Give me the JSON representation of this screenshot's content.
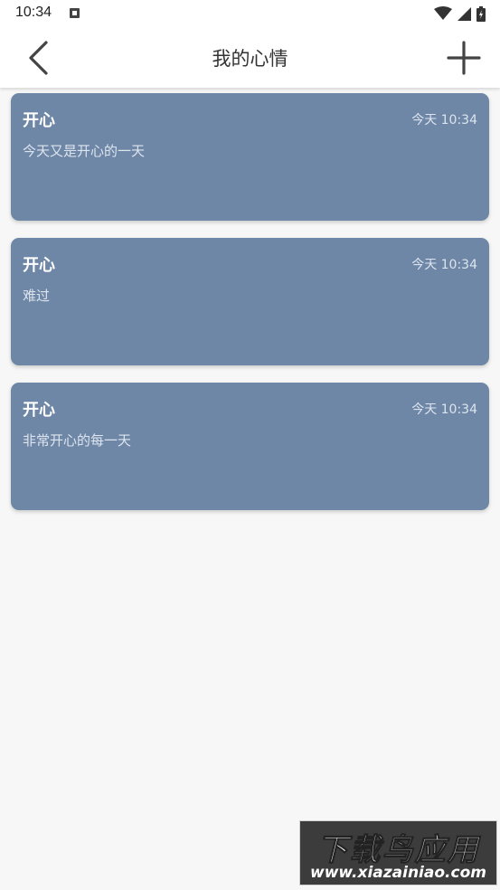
{
  "status_bar": {
    "time": "10:34",
    "notification_icon": "a-notification-icon",
    "icons": [
      "wifi-icon",
      "signal-icon",
      "battery-icon"
    ]
  },
  "app_bar": {
    "title": "我的心情",
    "back_icon": "chevron-left-icon",
    "add_icon": "plus-icon"
  },
  "moods": [
    {
      "mood": "开心",
      "time": "今天 10:34",
      "text": "今天又是开心的一天"
    },
    {
      "mood": "开心",
      "time": "今天 10:34",
      "text": "难过"
    },
    {
      "mood": "开心",
      "time": "今天 10:34",
      "text": "非常开心的每一天"
    }
  ],
  "watermark": {
    "brand": "下载鸟应用",
    "url": "www.xiazainiao.com"
  },
  "colors": {
    "card_background": "#6e87a6",
    "page_background": "#f7f7f7",
    "app_bar_background": "#ffffff"
  }
}
